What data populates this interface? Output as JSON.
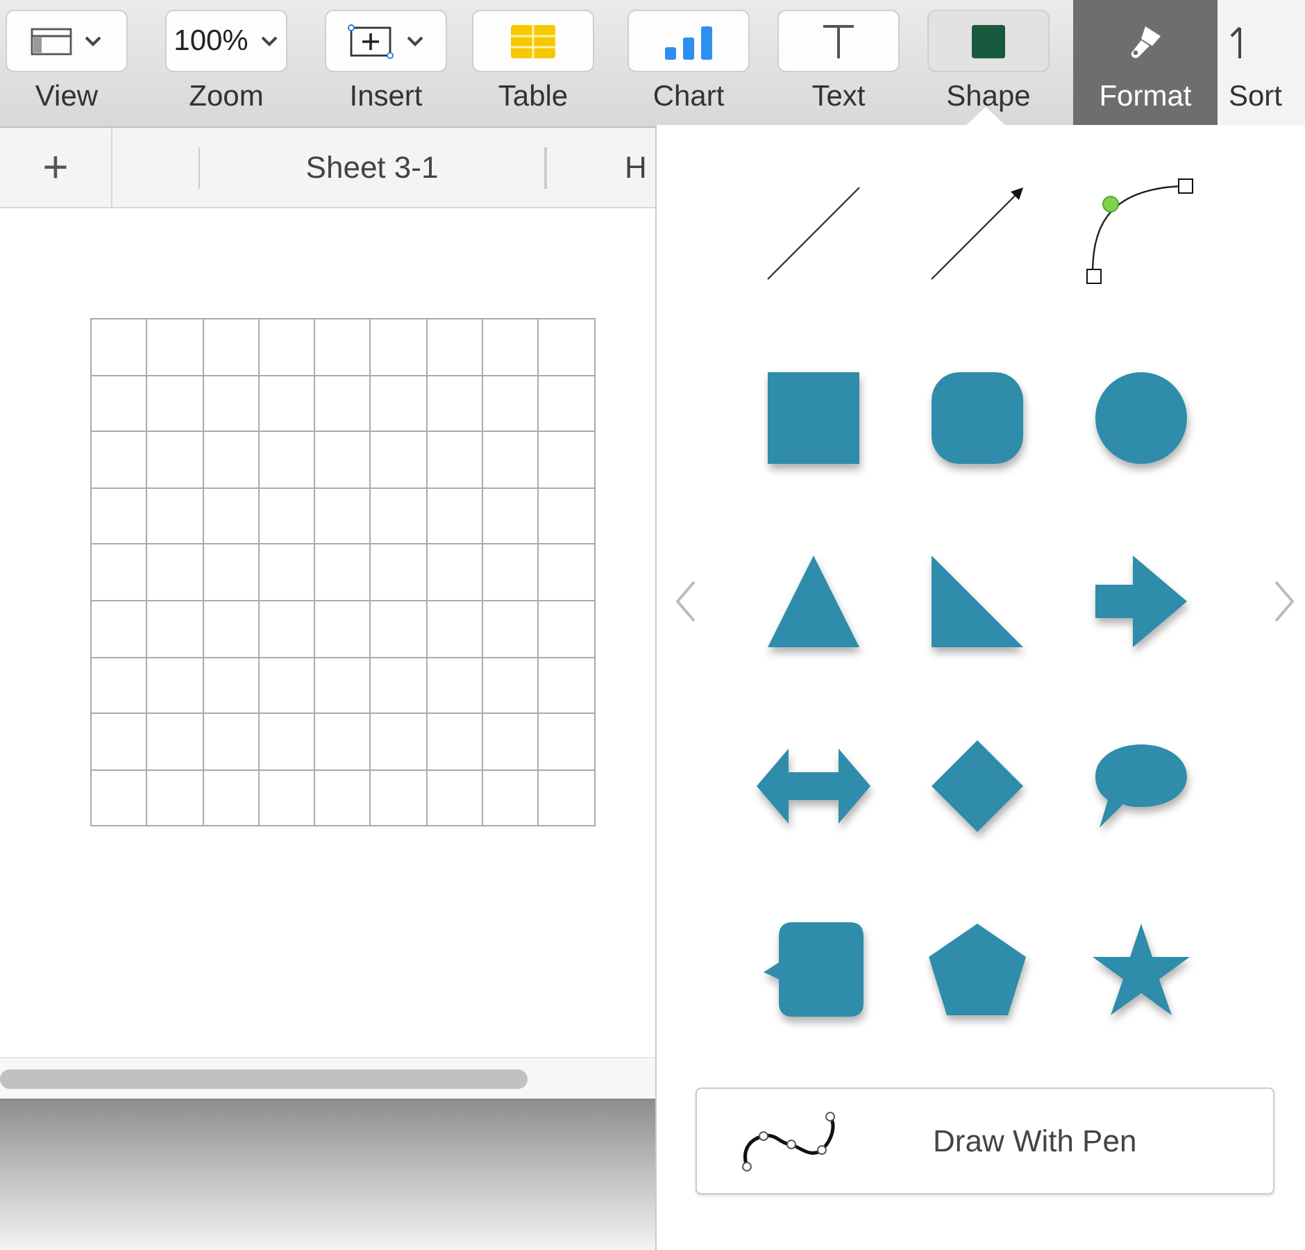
{
  "toolbar": [
    {
      "kind": "view",
      "label": "View",
      "selected": false,
      "open": false
    },
    {
      "kind": "zoom",
      "label": "Zoom",
      "value": "100%",
      "selected": false,
      "open": false
    },
    {
      "kind": "insert",
      "label": "Insert",
      "selected": false,
      "open": false
    },
    {
      "kind": "table",
      "label": "Table",
      "selected": false,
      "open": false
    },
    {
      "kind": "chart",
      "label": "Chart",
      "selected": false,
      "open": false
    },
    {
      "kind": "text",
      "label": "Text",
      "selected": false,
      "open": false
    },
    {
      "kind": "shape",
      "label": "Shape",
      "selected": false,
      "open": true
    },
    {
      "kind": "format",
      "label": "Format",
      "selected": true,
      "open": false
    },
    {
      "kind": "sort",
      "label": "Sort",
      "selected": false,
      "open": false
    }
  ],
  "sheet_tabs": {
    "add": "+",
    "tabs": [
      {
        "label": "Sheet 3-1"
      },
      {
        "label": "H"
      }
    ]
  },
  "popover": {
    "shapes": [
      {
        "kind": "line"
      },
      {
        "kind": "arrow"
      },
      {
        "kind": "curve"
      },
      {
        "kind": "square"
      },
      {
        "kind": "rounded-square"
      },
      {
        "kind": "circle"
      },
      {
        "kind": "triangle"
      },
      {
        "kind": "right-triangle"
      },
      {
        "kind": "arrow-right"
      },
      {
        "kind": "double-arrow"
      },
      {
        "kind": "diamond"
      },
      {
        "kind": "speech-bubble"
      },
      {
        "kind": "callout"
      },
      {
        "kind": "pentagon"
      },
      {
        "kind": "star"
      }
    ],
    "pen_button": "Draw With Pen"
  }
}
